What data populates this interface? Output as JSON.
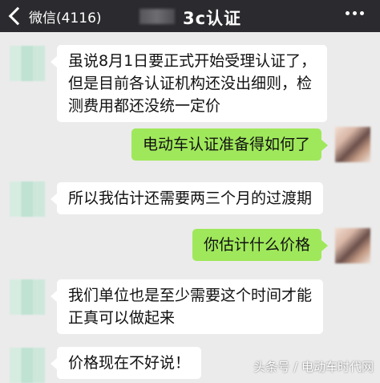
{
  "nav": {
    "back_label": "微信(4116)",
    "title": "3c认证"
  },
  "messages": [
    {
      "side": "left",
      "lines": [
        "虽说8月1日要正式开始受理认证了，",
        "但是目前各认证机构还没出细则，检",
        "测费用都还没统一定价"
      ]
    },
    {
      "side": "right",
      "lines": [
        "电动车认证准备得如何了"
      ]
    },
    {
      "side": "left",
      "lines": [
        "所以我估计还需要两三个月的过渡期"
      ]
    },
    {
      "side": "right",
      "lines": [
        "你估计什么价格"
      ]
    },
    {
      "side": "left",
      "lines": [
        "我们单位也是至少需要这个时间才能",
        "正真可以做起来"
      ]
    },
    {
      "side": "left",
      "lines": [
        "价格现在不好说！"
      ]
    }
  ],
  "watermark": "头条号 / 电动车时代网",
  "colors": {
    "nav_bg": "#2b2b2f",
    "chat_bg": "#ebebeb",
    "sent_bubble": "#9fe85b",
    "received_bubble": "#ffffff"
  }
}
